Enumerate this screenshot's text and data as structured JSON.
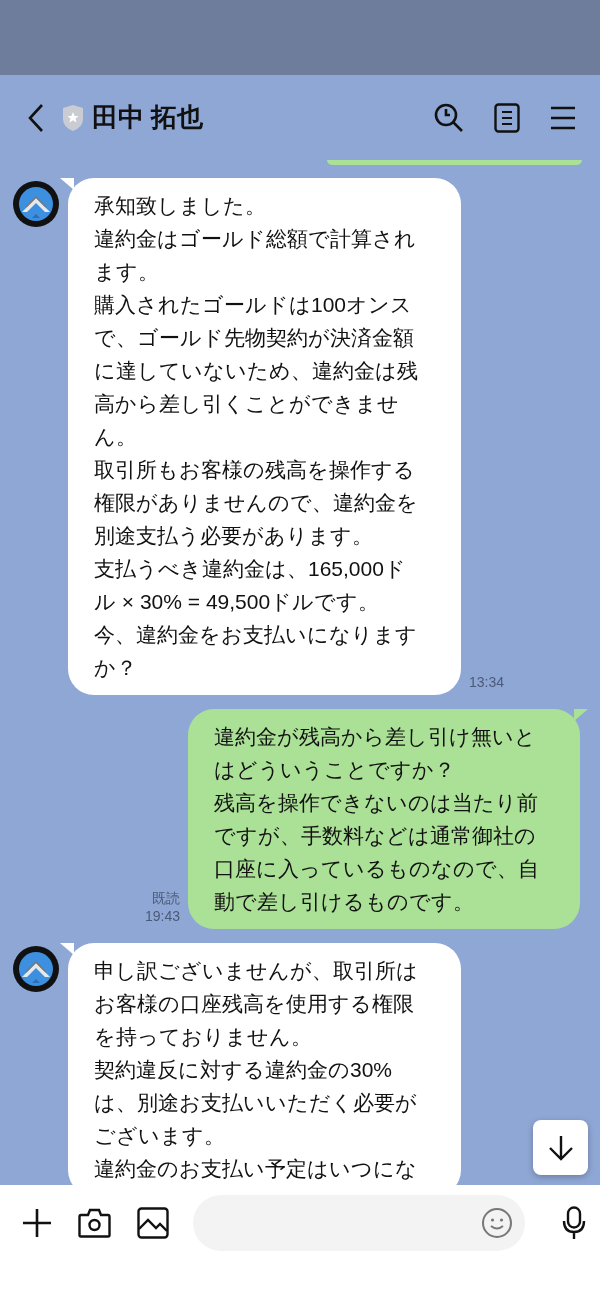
{
  "header": {
    "title": "田中 拓也"
  },
  "messages": [
    {
      "kind": "fragment"
    },
    {
      "kind": "incoming",
      "paragraphs": [
        "承知致しました。",
        "違約金はゴールド総額で計算されます。",
        "購入されたゴールドは100オンスで、ゴールド先物契約が決済金額に達していないため、違約金は残高から差し引くことができません。",
        "取引所もお客様の残高を操作する権限がありませんので、違約金を別途支払う必要があります。",
        "支払うべき違約金は、165,000ドル × 30% = 49,500ドルです。",
        "今、違約金をお支払いになりますか？"
      ],
      "time": "13:34"
    },
    {
      "kind": "outgoing",
      "paragraphs": [
        "違約金が残高から差し引け無いとはどういうことですか？",
        "残高を操作できないのは当たり前ですが、手数料などは通常御社の口座に入っているものなので、自動で差し引けるものです。"
      ],
      "read_label": "既読",
      "time": "19:43"
    },
    {
      "kind": "incoming",
      "paragraphs": [
        "申し訳ございませんが、取引所はお客様の口座残高を使用する権限を持っておりません。",
        "契約違反に対する違約金の30%は、別途お支払いいただく必要がございます。",
        "違約金のお支払い予定はいつにな"
      ]
    }
  ]
}
